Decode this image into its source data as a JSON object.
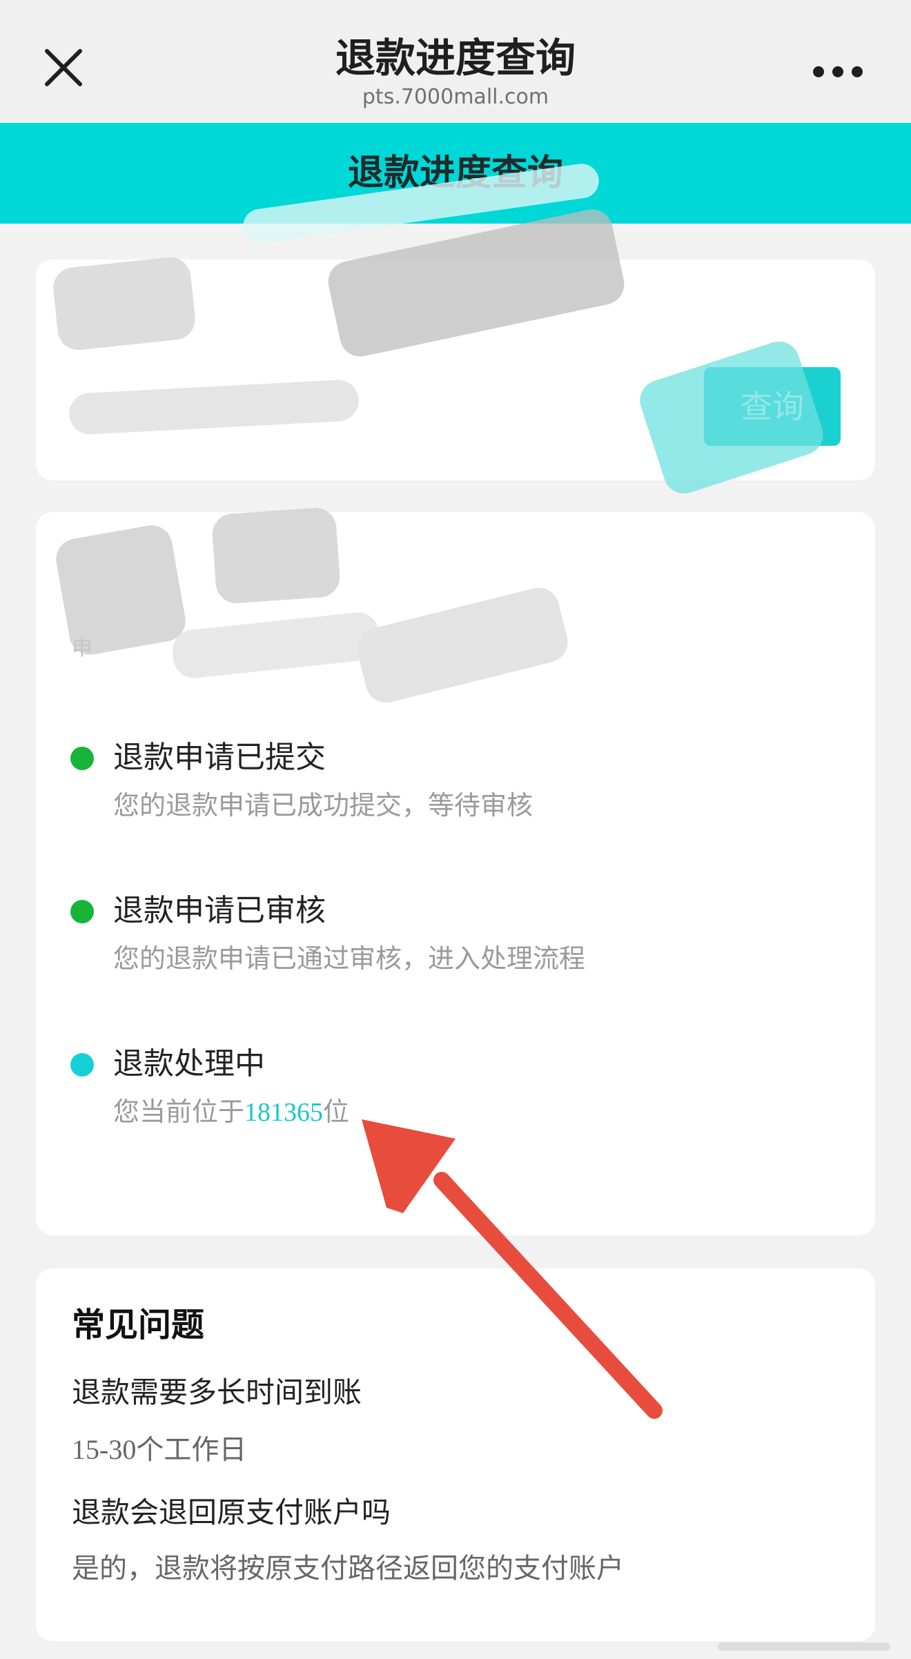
{
  "navbar": {
    "title": "退款进度查询",
    "domain": "pts.7000mall.com",
    "close_icon": "close-icon",
    "more_icon": "more-icon"
  },
  "header": {
    "title": "退款进度查询",
    "color": "#00d7d7"
  },
  "query": {
    "button_label": "查询",
    "input_value": ""
  },
  "status": {
    "partial_label": "申",
    "steps": [
      {
        "title": "退款申请已提交",
        "desc": "您的退款申请已成功提交，等待审核",
        "dot_color": "#16b53a"
      },
      {
        "title": "退款申请已审核",
        "desc": "您的退款申请已通过审核，进入处理流程",
        "dot_color": "#16b53a"
      },
      {
        "title": "退款处理中",
        "desc_prefix": "您当前位于",
        "queue_number": "181365",
        "desc_suffix": "位",
        "dot_color": "#16d0d8"
      }
    ]
  },
  "faq": {
    "title": "常见问题",
    "items": [
      {
        "q": "退款需要多长时间到账",
        "a": "15-30个工作日"
      },
      {
        "q": "退款会退回原支付账户吗",
        "a": "是的，退款将按原支付路径返回您的支付账户"
      }
    ]
  },
  "annotation": {
    "arrow_color": "#e84c3d"
  }
}
